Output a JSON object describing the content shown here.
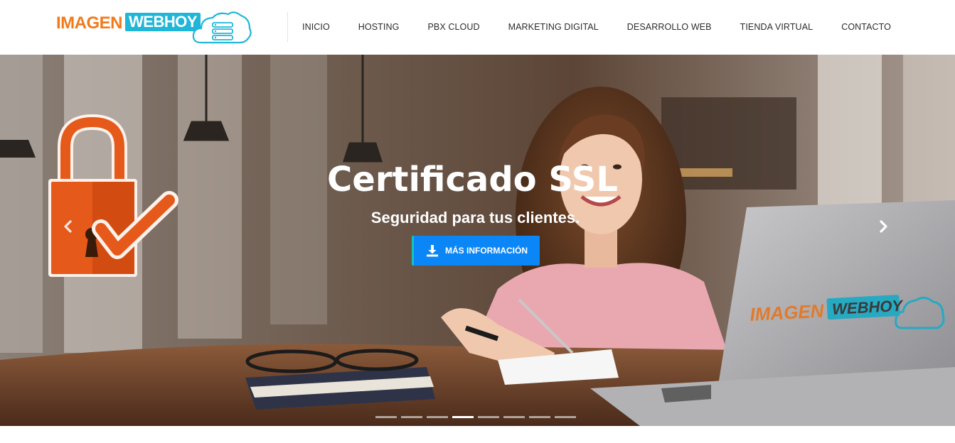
{
  "brand": {
    "part1": "IMAGEN",
    "part2": "WEBHOY",
    "icon": "cloud-server-icon",
    "color_orange": "#f27a1a",
    "color_cyan": "#1fb6d8"
  },
  "nav": {
    "items": [
      {
        "label": "INICIO"
      },
      {
        "label": "HOSTING"
      },
      {
        "label": "PBX CLOUD"
      },
      {
        "label": "MARKETING DIGITAL"
      },
      {
        "label": "DESARROLLO WEB"
      },
      {
        "label": "TIENDA VIRTUAL"
      },
      {
        "label": "CONTACTO"
      }
    ]
  },
  "hero": {
    "title": "Certificado SSL",
    "subtitle": "Seguridad para tus clientes.",
    "cta_label": "MÁS INFORMACIÓN",
    "cta_icon": "download-icon",
    "cta_color": "#0b86f7",
    "prev_icon": "chevron-left-icon",
    "next_icon": "chevron-right-icon",
    "slides_count": 8,
    "active_slide": 4,
    "laptop_logo": {
      "part1": "IMAGEN",
      "part2": "WEBHOY"
    }
  }
}
